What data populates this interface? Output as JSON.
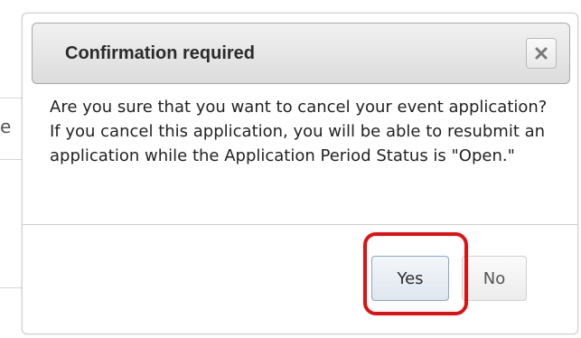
{
  "background": {
    "partial_text": "e"
  },
  "dialog": {
    "title": "Confirmation required",
    "close_icon": "close-x-icon",
    "message": "Are you sure that you want to cancel your event application? If you cancel this application, you will be able to resubmit an application while the Application Period Status is \"Open.\"",
    "buttons": {
      "yes_label": "Yes",
      "no_label": "No"
    }
  },
  "annotation": {
    "highlight_color": "#e01010",
    "highlight_target": "Yes"
  }
}
